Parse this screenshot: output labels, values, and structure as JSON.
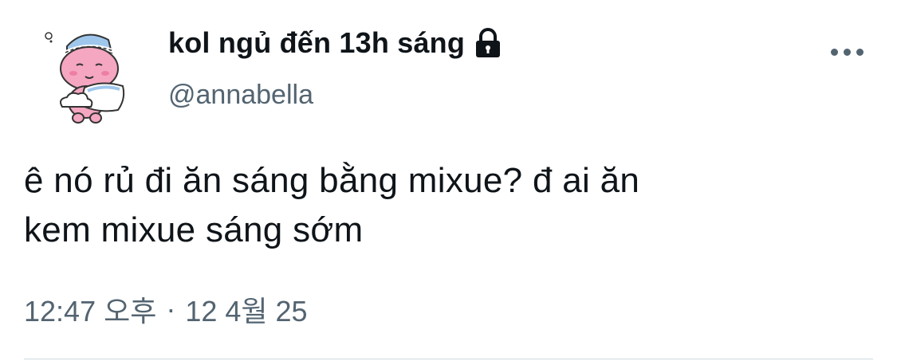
{
  "tweet": {
    "display_name": "kol ngủ đến 13h sáng",
    "handle": "@annabella",
    "text": "ê nó rủ đi ăn sáng bằng mixue? đ ai ăn\nkem mixue sáng sớm",
    "time": "12:47 오후",
    "separator": "·",
    "date": "12 4월 25",
    "locked": true
  },
  "icons": {
    "lock": "lock-icon",
    "more": "more-options-icon",
    "avatar": "pink-bear-with-pillow-avatar"
  },
  "colors": {
    "primary_text": "#0f1419",
    "secondary_text": "#536471",
    "divider": "#cfd9de",
    "avatar_pink": "#f5a6c0",
    "avatar_blue": "#9fc7ec"
  }
}
